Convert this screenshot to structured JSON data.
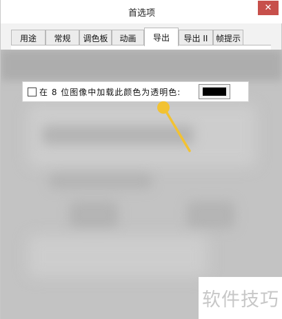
{
  "window": {
    "title": "首选项",
    "close_glyph": "✕"
  },
  "tabs": [
    {
      "label": "用途"
    },
    {
      "label": "常规"
    },
    {
      "label": "调色板"
    },
    {
      "label": "动画"
    },
    {
      "label": "导出",
      "active": true
    },
    {
      "label": "导出 II"
    },
    {
      "label": "帧提示"
    }
  ],
  "option": {
    "checked": false,
    "label": "在 8 位图像中加载此颜色为透明色:",
    "swatch_color": "#000000"
  },
  "annotation": {
    "color": "#f2c232"
  },
  "watermark": {
    "text": "软件技巧"
  }
}
